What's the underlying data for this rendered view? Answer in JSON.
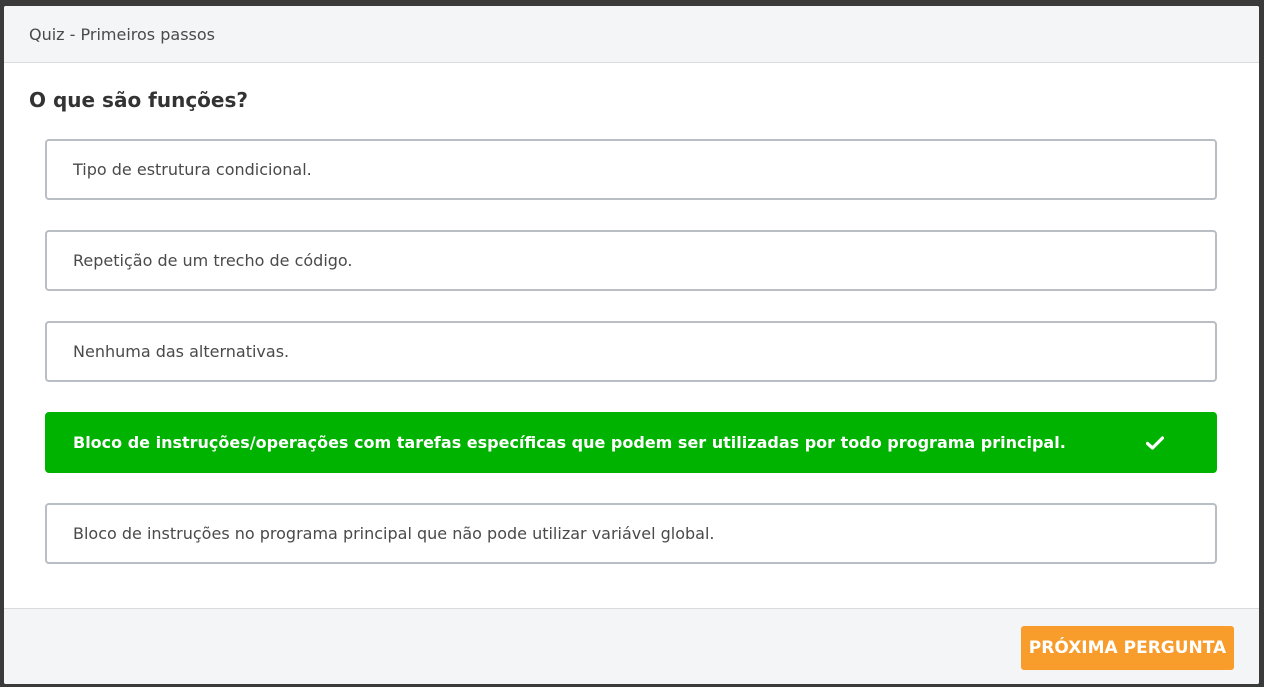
{
  "header": {
    "title": "Quiz - Primeiros passos"
  },
  "question": {
    "text": "O que são funções?"
  },
  "options": [
    {
      "text": "Tipo de estrutura condicional.",
      "selected": false
    },
    {
      "text": "Repetição de um trecho de código.",
      "selected": false
    },
    {
      "text": "Nenhuma das alternativas.",
      "selected": false
    },
    {
      "text": "Bloco de instruções/operações com tarefas específicas que podem ser utilizadas por todo programa principal.",
      "selected": true,
      "icon": "check-icon"
    },
    {
      "text": "Bloco de instruções no programa principal que não pode utilizar variável global.",
      "selected": false
    }
  ],
  "footer": {
    "next_label": "PRÓXIMA PERGUNTA"
  },
  "colors": {
    "selected": "#00b300",
    "button": "#f89c2c",
    "border": "#b9bec4"
  }
}
